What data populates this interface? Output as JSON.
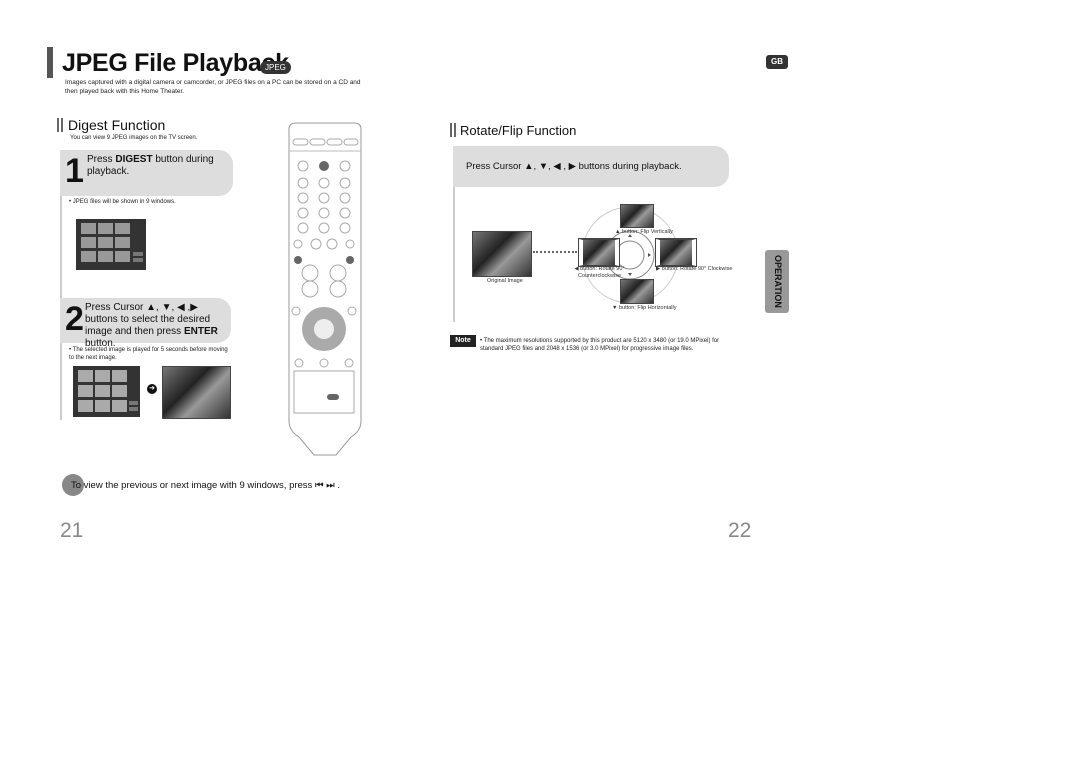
{
  "header": {
    "title": "JPEG File Playback",
    "badge": "JPEG",
    "intro": "Images captured with a digital camera or camcorder, or JPEG files on a PC can be stored on a CD and then played back with this Home Theater.",
    "region_badge": "GB"
  },
  "digest": {
    "heading": "Digest Function",
    "subtitle": "You can view 9 JPEG images on the TV screen.",
    "step1": {
      "number": "1",
      "text_pre": "Press ",
      "text_bold": "DIGEST",
      "text_post": " button during playback.",
      "bullet": "• JPEG files will be shown in 9 windows."
    },
    "step2": {
      "number": "2",
      "text_pre": "Press Cursor ▲, ▼, ◀ ,▶ buttons to select the desired image and then press ",
      "text_bold": "ENTER",
      "text_post": " button.",
      "bullet": "• The selected image is played for 5 seconds before moving to the next image."
    },
    "footer_tip": "To view the previous or next image with 9 windows, press ⏮ ⏭ ."
  },
  "rotate": {
    "heading": "Rotate/Flip Function",
    "instruction": "Press Cursor ▲, ▼, ◀ , ▶ buttons during playback.",
    "original_caption": "Original Image",
    "up_caption": "▲ button: Flip Vertically",
    "left_caption": "◀ button: Rotate 90° Counterclockwise",
    "right_caption": "▶ button: Rotate 90° Clockwise",
    "down_caption": "▼ button: Flip Horizontally"
  },
  "note": {
    "label": "Note",
    "text": "• The maximum resolutions supported by this product are 5120 x 3480 (or 19.0 MPixel) for standard JPEG files and 2048 x 1536 (or 3.0 MPixel) for progressive image files."
  },
  "side_tab": "OPERATION",
  "page_numbers": {
    "left": "21",
    "right": "22"
  }
}
